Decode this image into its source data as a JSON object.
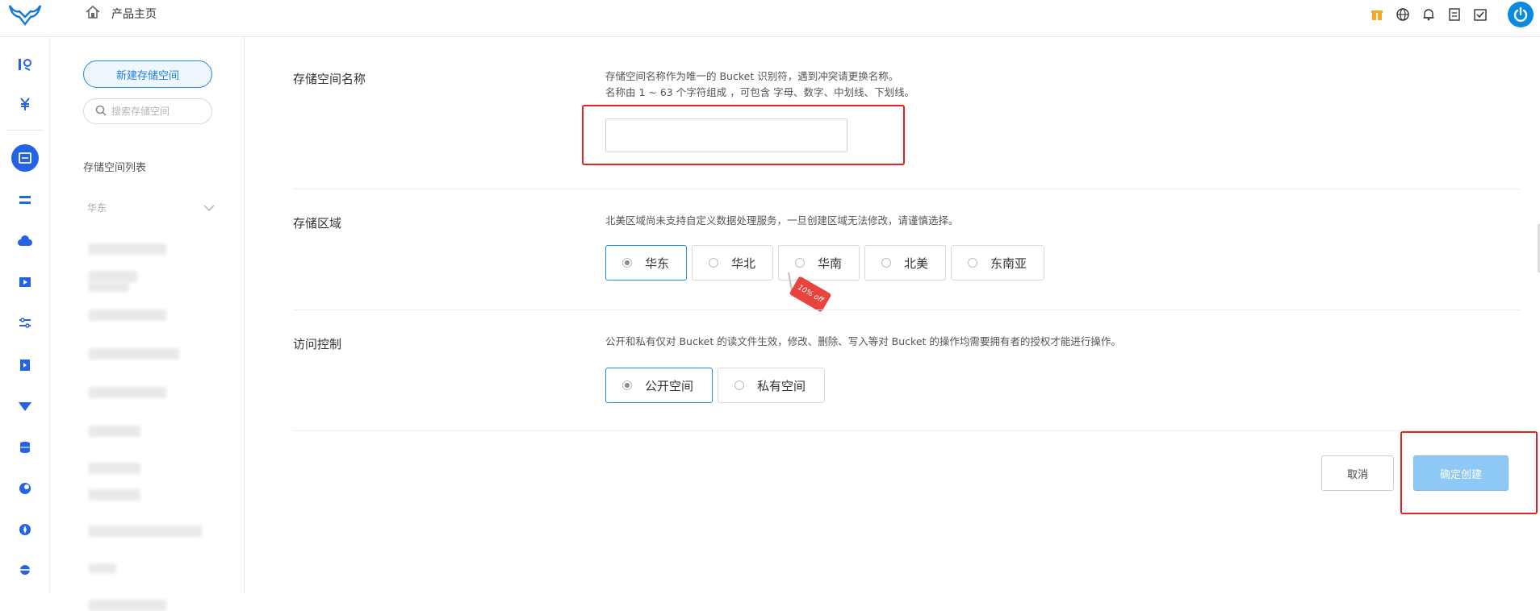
{
  "topbar": {
    "home_label": "产品主页",
    "icons": [
      "logo-icon",
      "home-icon",
      "gift-icon",
      "globe-icon",
      "bell-icon",
      "document-icon",
      "task-icon",
      "power-icon"
    ]
  },
  "rail": {
    "icons": [
      "dashboard-icon",
      "yuan-icon",
      "storage-icon",
      "list-icon",
      "cloud-icon",
      "video-icon",
      "settings-icon",
      "media-icon",
      "cdn-icon",
      "database-icon",
      "moon-icon",
      "compass-icon",
      "planet-icon"
    ]
  },
  "sidebar": {
    "new_button": "新建存储空间",
    "search_placeholder": "搜索存储空间",
    "list_title": "存储空间列表",
    "region": "华东"
  },
  "form": {
    "name": {
      "label": "存储空间名称",
      "desc1": "存储空间名称作为唯一的 Bucket 识别符，遇到冲突请更换名称。",
      "desc2": "名称由 1 ~ 63 个字符组成 ，可包含 字母、数字、中划线、下划线。",
      "value": ""
    },
    "region": {
      "label": "存储区域",
      "desc": "北美区域尚未支持自定义数据处理服务，一旦创建区域无法修改，请谨慎选择。",
      "options": [
        "华东",
        "华北",
        "华南",
        "北美",
        "东南亚"
      ],
      "selected": "华东",
      "promo_tag": "10% off"
    },
    "access": {
      "label": "访问控制",
      "desc": "公开和私有仅对 Bucket 的读文件生效，修改、删除、写入等对 Bucket 的操作均需要拥有者的授权才能进行操作。",
      "options": [
        "公开空间",
        "私有空间"
      ],
      "selected": "公开空间"
    }
  },
  "actions": {
    "cancel": "取消",
    "confirm": "确定创建"
  },
  "colors": {
    "accent": "#1f8ce6",
    "highlight": "#e32222",
    "confirm_disabled": "#8ec8f5"
  }
}
